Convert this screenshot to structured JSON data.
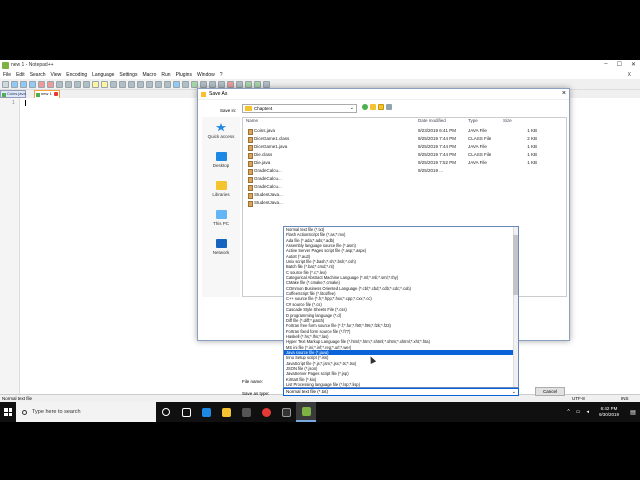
{
  "window": {
    "title": "new 1 - Notepad++",
    "controls": [
      "–",
      "☐",
      "✕"
    ],
    "menu": [
      "File",
      "Edit",
      "Search",
      "View",
      "Encoding",
      "Language",
      "Settings",
      "Macro",
      "Run",
      "Plugins",
      "Window",
      "?"
    ],
    "menu_right": "X"
  },
  "tabs": {
    "doc_selector": "Coins.java",
    "active_tab": "new 1"
  },
  "editor": {
    "line_number": "1"
  },
  "statusbar": {
    "left": "Normal text file",
    "ins": "INS",
    "encoding": "UTF-8"
  },
  "taskbar": {
    "search_placeholder": "Type here to search",
    "time": "6:42 PM",
    "date": "9/30/2019"
  },
  "dialog": {
    "title": "Save As",
    "save_in_label": "Save in:",
    "save_in_value": "Chapter4",
    "places": [
      "Quick access",
      "Desktop",
      "Libraries",
      "This PC",
      "Network"
    ],
    "columns": [
      "Name",
      "Date modified",
      "Type",
      "Size"
    ],
    "files": [
      {
        "name": "Coins.java",
        "date": "9/23/2019 6:41 PM",
        "type": "JAVA File",
        "size": "1 KB"
      },
      {
        "name": "DiceGame1.class",
        "date": "9/25/2019 7:44 PM",
        "type": "CLASS File",
        "size": "2 KB"
      },
      {
        "name": "DiceGame1.java",
        "date": "9/25/2019 7:44 PM",
        "type": "JAVA File",
        "size": "1 KB"
      },
      {
        "name": "Die.class",
        "date": "9/25/2019 7:44 PM",
        "type": "CLASS File",
        "size": "1 KB"
      },
      {
        "name": "Die.java",
        "date": "9/25/2019 7:52 PM",
        "type": "JAVA File",
        "size": "1 KB"
      },
      {
        "name": "GradeCalcu...",
        "date": "9/25/2019 ...",
        "type": "",
        "size": ""
      },
      {
        "name": "GradeCalcu...",
        "date": "",
        "type": "",
        "size": ""
      },
      {
        "name": "GradeCalcu...",
        "date": "",
        "type": "",
        "size": ""
      },
      {
        "name": "StudentJava...",
        "date": "",
        "type": "",
        "size": ""
      },
      {
        "name": "StudentJava...",
        "date": "",
        "type": "",
        "size": ""
      }
    ],
    "file_name_label": "File name:",
    "save_type_label": "Save as type:",
    "save_type_value": "Normal text file (*.txt)",
    "cancel_label": "Cancel"
  },
  "dropdown": {
    "selected_index": 23,
    "options": [
      "Normal text file (*.txt)",
      "Flash ActionScript file (*.as;*.mx)",
      "Ada file (*.ada;*.ads;*.adb)",
      "Assembly language source file (*.asm)",
      "Active Server Pages script file (*.asp;*.aspx)",
      "AutoIt (*.au3)",
      "Unix script file (*.bash;*.sh;*.bsh;*.csh)",
      "Batch file (*.bat;*.cmd;*.nt)",
      "C source file (*.c;*.lex)",
      "Categorical Abstract Machine Language (*.ml;*.mli;*.sml;*.thy)",
      "CMake file (*.cmake;*.cmake)",
      "COmmon Business Oriented Language (*.cbl;*.cbd;*.cdb;*.cdc;*.cob)",
      "CoffeeScript file (*.litcoffee)",
      "C++ source file (*.h;*.hpp;*.hxx;*.cpp;*.cxx;*.cc)",
      "C# source file (*.cs)",
      "Cascade Style Sheets File (*.css)",
      "D programming language (*.d)",
      "Diff file (*.diff;*.patch)",
      "Fortran free form source file (*.f;*.for;*.f90;*.f95;*.f2k;*.f23)",
      "Fortran fixed form source file (*.f77)",
      "Haskell (*.hs;*.lhs;*.las)",
      "Hyper Text Markup Language file (*.html;*.htm;*.shtml;*.shtm;*.xhtml;*.xht;*.hta)",
      "MS ini file (*.ini;*.inf;*.reg;*.url;*.wer)",
      "Java source file (*.java)",
      "Inno Setup script (*.iss)",
      "JavaScript file (*.js;*.jsm;*.jsx;*.ts;*.tsx)",
      "JSON file (*.json)",
      "JavaServer Pages script file (*.jsp)",
      "KiXtart file (*.kix)",
      "List Processing language file (*.lsp;*.lisp)"
    ]
  }
}
